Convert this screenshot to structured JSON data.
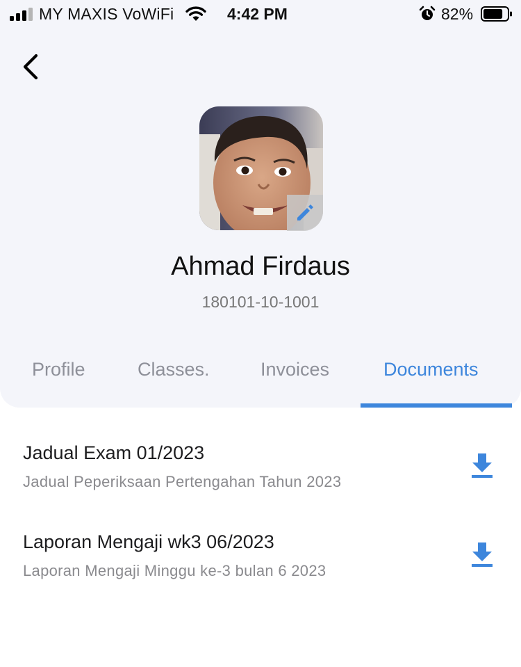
{
  "status_bar": {
    "carrier": "MY MAXIS VoWiFi",
    "time": "4:42 PM",
    "battery": "82%",
    "battery_level": 0.82
  },
  "profile": {
    "name": "Ahmad Firdaus",
    "id_number": "180101-10-1001"
  },
  "tabs": [
    {
      "label": "Profile",
      "active": false
    },
    {
      "label": "Classes.",
      "active": false
    },
    {
      "label": "Invoices",
      "active": false
    },
    {
      "label": "Documents",
      "active": true
    }
  ],
  "documents": [
    {
      "title": "Jadual Exam 01/2023",
      "description": "Jadual Peperiksaan Pertengahan Tahun 2023"
    },
    {
      "title": "Laporan Mengaji wk3 06/2023",
      "description": "Laporan Mengaji Minggu ke-3 bulan 6 2023"
    }
  ],
  "colors": {
    "accent": "#3d86dc",
    "header_background": "#f4f5fa",
    "inactive_tab": "#8e9099"
  },
  "icons": {
    "back": "chevron-left-icon",
    "edit": "pencil-icon",
    "download": "download-icon"
  }
}
